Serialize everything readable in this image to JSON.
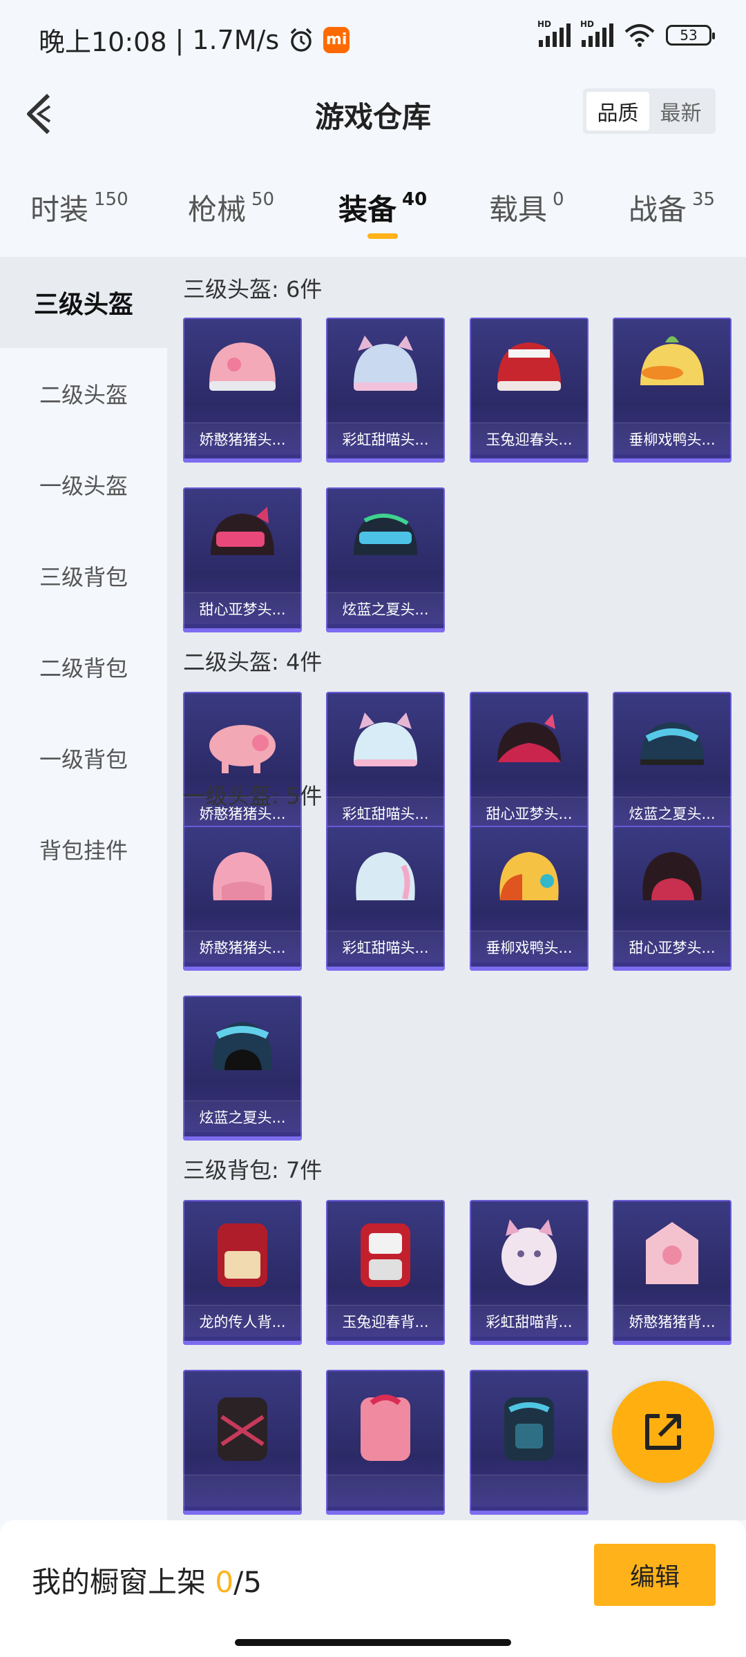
{
  "status": {
    "time": "晚上10:08",
    "speed": "1.7M/s",
    "mi_label": "mi",
    "signal1": "HD",
    "signal2": "HD",
    "battery": "53"
  },
  "header": {
    "title": "游戏仓库",
    "sort_quality": "品质",
    "sort_newest": "最新"
  },
  "tabs": [
    {
      "label": "时装",
      "count": "150"
    },
    {
      "label": "枪械",
      "count": "50"
    },
    {
      "label": "装备",
      "count": "40"
    },
    {
      "label": "载具",
      "count": "0"
    },
    {
      "label": "战备",
      "count": "35"
    }
  ],
  "sidebar": [
    "三级头盔",
    "二级头盔",
    "一级头盔",
    "三级背包",
    "二级背包",
    "一级背包",
    "背包挂件"
  ],
  "sections": [
    {
      "title": "三级头盔: 6件",
      "items": [
        "娇憨猪猪头...",
        "彩虹甜喵头...",
        "玉兔迎春头...",
        "垂柳戏鸭头...",
        "甜心亚梦头...",
        "炫蓝之夏头..."
      ]
    },
    {
      "title": "二级头盔: 4件",
      "items": [
        "娇憨猪猪头...",
        "彩虹甜喵头...",
        "甜心亚梦头...",
        "炫蓝之夏头..."
      ]
    },
    {
      "title": "一级头盔: 5件",
      "items": [
        "娇憨猪猪头...",
        "彩虹甜喵头...",
        "垂柳戏鸭头...",
        "甜心亚梦头...",
        "炫蓝之夏头..."
      ]
    },
    {
      "title": "三级背包: 7件",
      "items": [
        "龙的传人背...",
        "玉兔迎春背...",
        "彩虹甜喵背...",
        "娇憨猪猪背...",
        "",
        "",
        ""
      ]
    }
  ],
  "colors": {
    "accent": "#ffb21a",
    "card_bg": "#2c2a66",
    "card_border": "#6a5ad6"
  },
  "bottom": {
    "shelf_label": "我的橱窗上架 ",
    "shelf_current": "0",
    "shelf_total": "/5",
    "edit": "编辑"
  },
  "icons": {
    "back": "back-chevron-icon",
    "fab": "share-external-icon",
    "alarm": "alarm-icon",
    "wifi": "wifi-icon"
  }
}
